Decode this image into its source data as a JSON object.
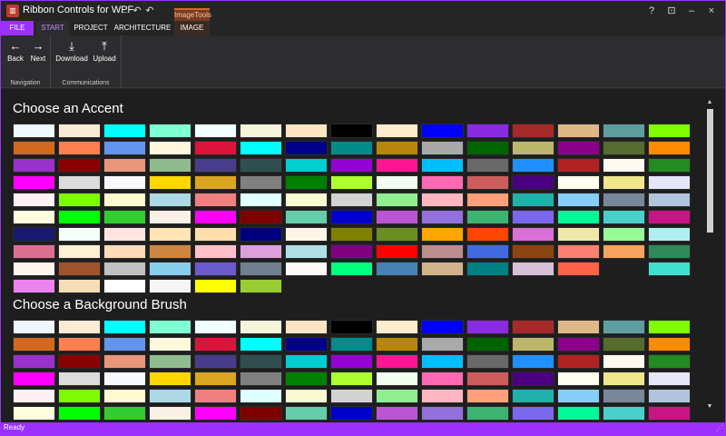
{
  "window": {
    "title": "Ribbon Controls for WPF",
    "app_icon_glyph": "▥",
    "controls": [
      "?",
      "⊡",
      "–",
      "×"
    ]
  },
  "quick_access": [
    "←",
    "↶",
    "↶"
  ],
  "contextual_group": "ImageTools",
  "tabs": {
    "file": "FILE",
    "start": "START",
    "project": "PROJECT",
    "architecture": "ARCHITECTURE",
    "image": "IMAGE"
  },
  "ribbon": {
    "navigation": {
      "label": "Navigation",
      "back": "Back",
      "next": "Next"
    },
    "communications": {
      "label": "Communications",
      "download": "Download",
      "upload": "Upload"
    }
  },
  "sections": {
    "accent_title": "Choose an Accent",
    "background_title": "Choose a Background Brush"
  },
  "accent_colors": [
    "#f0f8ff",
    "#faebd7",
    "#00ffff",
    "#7fffd4",
    "#f0ffff",
    "#f5f5dc",
    "#ffe4c4",
    "#000000",
    "#ffebcd",
    "#0000ff",
    "#8a2be2",
    "#a52a2a",
    "#deb887",
    "#5f9ea0",
    "#7fff00",
    "#d2691e",
    "#ff7f50",
    "#6495ed",
    "#fff8dc",
    "#dc143c",
    "#00ffff",
    "#00008b",
    "#008b8b",
    "#b8860b",
    "#a9a9a9",
    "#006400",
    "#bdb76b",
    "#8b008b",
    "#556b2f",
    "#ff8c00",
    "#9932cc",
    "#8b0000",
    "#e9967a",
    "#8fbc8f",
    "#483d8b",
    "#2f4f4f",
    "#00ced1",
    "#9400d3",
    "#ff1493",
    "#00bfff",
    "#696969",
    "#1e90ff",
    "#b22222",
    "#fffaf0",
    "#228b22",
    "#ff00ff",
    "#dcdcdc",
    "#f8f8ff",
    "#ffd700",
    "#daa520",
    "#808080",
    "#008000",
    "#adff2f",
    "#f0fff0",
    "#ff69b4",
    "#cd5c5c",
    "#4b0082",
    "#fffff0",
    "#f0e68c",
    "#e6e6fa",
    "#fff0f5",
    "#7cfc00",
    "#fffacd",
    "#add8e6",
    "#f08080",
    "#e0ffff",
    "#fafad2",
    "#d3d3d3",
    "#90ee90",
    "#ffb6c1",
    "#ffa07a",
    "#20b2aa",
    "#87cefa",
    "#778899",
    "#b0c4de",
    "#ffffe0",
    "#00ff00",
    "#32cd32",
    "#faf0e6",
    "#ff00ff",
    "#800000",
    "#66cdaa",
    "#0000cd",
    "#ba55d3",
    "#9370db",
    "#3cb371",
    "#7b68ee",
    "#00fa9a",
    "#48d1cc",
    "#c71585",
    "#191970",
    "#f5fffa",
    "#ffe4e1",
    "#ffe4b5",
    "#ffdead",
    "#000080",
    "#fdf5e6",
    "#808000",
    "#6b8e23",
    "#ffa500",
    "#ff4500",
    "#da70d6",
    "#eee8aa",
    "#98fb98",
    "#afeeee",
    "#db7093",
    "#ffefd5",
    "#ffdab9",
    "#cd853f",
    "#ffc0cb",
    "#dda0dd",
    "#b0e0e6",
    "#800080",
    "#ff0000",
    "#bc8f8f",
    "#4169e1",
    "#8b4513",
    "#fa8072",
    "#f4a460",
    "#2e8b57",
    "#fff5ee",
    "#a0522d",
    "#c0c0c0",
    "#87ceeb",
    "#6a5acd",
    "#708090",
    "#fffafa",
    "#00ff7f",
    "#4682b4",
    "#d2b48c",
    "#008080",
    "#d8bfd8",
    "#ff6347",
    "transparent",
    "#40e0d0",
    "#ee82ee",
    "#f5deb3",
    "#ffffff",
    "#f5f5f5",
    "#ffff00",
    "#9acd32"
  ],
  "background_colors": [
    "#f0f8ff",
    "#faebd7",
    "#00ffff",
    "#7fffd4",
    "#f0ffff",
    "#f5f5dc",
    "#ffe4c4",
    "#000000",
    "#ffebcd",
    "#0000ff",
    "#8a2be2",
    "#a52a2a",
    "#deb887",
    "#5f9ea0",
    "#7fff00",
    "#d2691e",
    "#ff7f50",
    "#6495ed",
    "#fff8dc",
    "#dc143c",
    "#00ffff",
    "#00008b",
    "#008b8b",
    "#b8860b",
    "#a9a9a9",
    "#006400",
    "#bdb76b",
    "#8b008b",
    "#556b2f",
    "#ff8c00",
    "#9932cc",
    "#8b0000",
    "#e9967a",
    "#8fbc8f",
    "#483d8b",
    "#2f4f4f",
    "#00ced1",
    "#9400d3",
    "#ff1493",
    "#00bfff",
    "#696969",
    "#1e90ff",
    "#b22222",
    "#fffaf0",
    "#228b22",
    "#ff00ff",
    "#dcdcdc",
    "#f8f8ff",
    "#ffd700",
    "#daa520",
    "#808080",
    "#008000",
    "#adff2f",
    "#f0fff0",
    "#ff69b4",
    "#cd5c5c",
    "#4b0082",
    "#fffff0",
    "#f0e68c",
    "#e6e6fa",
    "#fff0f5",
    "#7cfc00",
    "#fffacd",
    "#add8e6",
    "#f08080",
    "#e0ffff",
    "#fafad2",
    "#d3d3d3",
    "#90ee90",
    "#ffb6c1",
    "#ffa07a",
    "#20b2aa",
    "#87cefa",
    "#778899",
    "#b0c4de",
    "#ffffe0",
    "#00ff00",
    "#32cd32",
    "#faf0e6",
    "#ff00ff",
    "#800000",
    "#66cdaa",
    "#0000cd",
    "#ba55d3",
    "#9370db",
    "#3cb371",
    "#7b68ee",
    "#00fa9a",
    "#48d1cc",
    "#c71585"
  ],
  "status": {
    "text": "Ready",
    "grip": "⋰"
  },
  "scroll": {
    "up": "▲",
    "down": "▼"
  },
  "theme": {
    "accent": "#9b30ff",
    "background": "#1e1e1e",
    "ribbon": "#2d2d30"
  }
}
